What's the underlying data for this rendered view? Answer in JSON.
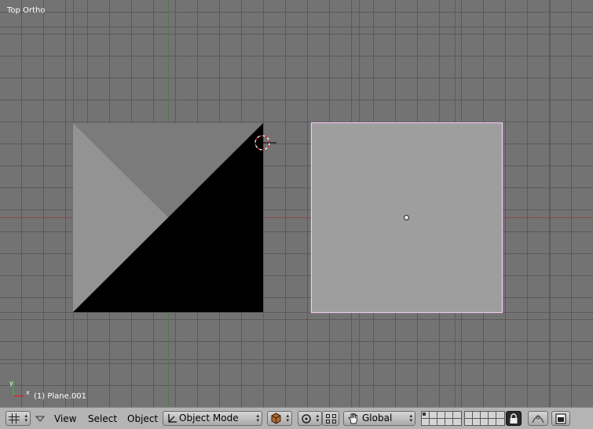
{
  "viewport": {
    "view_name": "Top Ortho",
    "object_info": "(1) Plane.001",
    "colors": {
      "background": "#737373",
      "grid_line": "#5e5e5e",
      "x_axis": "#8a4a4a",
      "y_axis": "#4f7a4f",
      "light_face": "#929292",
      "dark_face": "#000000",
      "selected_plane": "#9e9e9e",
      "selection_outline": "#f0c8f0"
    }
  },
  "header": {
    "menus": {
      "view": "View",
      "select": "Select",
      "object": "Object"
    },
    "mode": "Object Mode",
    "orientation": "Global",
    "icons": {
      "editor_type": "grid-icon",
      "collapse": "triangle-down-icon",
      "draw_type": "cube-draw-icon",
      "pivot": "pivot-icon",
      "manipulator": "manipulator-icon",
      "hand": "hand-icon",
      "layers": "layer-grid-icon",
      "lock": "lock-icon",
      "proportional": "proportional-edit-icon",
      "render": "render-icon"
    }
  }
}
